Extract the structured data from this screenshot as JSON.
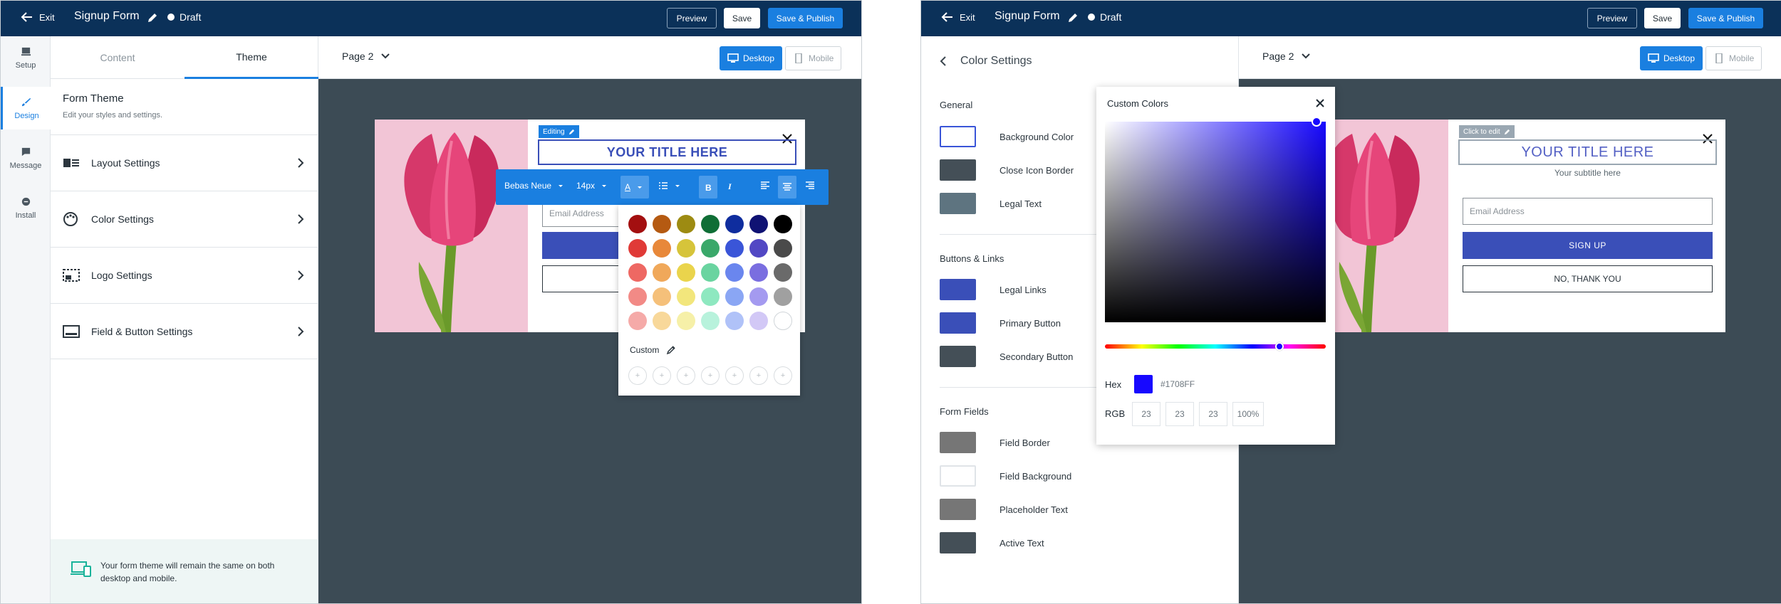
{
  "header": {
    "exit_label": "Exit",
    "form_name": "Signup Form",
    "status": "Draft",
    "preview_label": "Preview",
    "save_label": "Save",
    "publish_label": "Save & Publish"
  },
  "rail": {
    "items": [
      {
        "label": "Setup",
        "icon": "setup-icon"
      },
      {
        "label": "Design",
        "icon": "brush-icon"
      },
      {
        "label": "Message",
        "icon": "message-icon"
      },
      {
        "label": "Install",
        "icon": "install-icon"
      }
    ],
    "active": "Design"
  },
  "panel": {
    "tabs": [
      "Content",
      "Theme"
    ],
    "active_tab": "Theme",
    "title": "Form Theme",
    "subtitle": "Edit your styles and settings.",
    "sections": [
      {
        "label": "Layout Settings",
        "icon": "layout-icon"
      },
      {
        "label": "Color Settings",
        "icon": "palette-icon"
      },
      {
        "label": "Logo Settings",
        "icon": "logo-icon"
      },
      {
        "label": "Field & Button Settings",
        "icon": "field-button-icon"
      }
    ],
    "footer": "Your form theme will remain the same on both desktop and mobile."
  },
  "canvas": {
    "page_label": "Page 2",
    "desktop_label": "Desktop",
    "mobile_label": "Mobile",
    "bg_color": "#3c4b55"
  },
  "form": {
    "title": "YOUR TITLE HERE",
    "subtitle": "Your subtitle here",
    "email_placeholder": "Email Address",
    "primary_button": "SIGN UP",
    "secondary_button": "NO, THANK YOU",
    "editing_tag": "Editing",
    "click_to_edit_tag": "Click to edit",
    "accent_color": "#3a4fb8"
  },
  "toolbar": {
    "font": "Bebas Neue",
    "size": "14px",
    "text_color_icon": "A",
    "custom_label": "Custom",
    "palette": [
      [
        "#a30f10",
        "#b55a12",
        "#9d8b12",
        "#0f6e36",
        "#0f2d9e",
        "#0f1273",
        "#000000"
      ],
      [
        "#e03a37",
        "#e8883a",
        "#d6c43a",
        "#3aa86a",
        "#3a55d8",
        "#5248c4",
        "#4a4a4a"
      ],
      [
        "#ee6863",
        "#f0a85a",
        "#ead44c",
        "#6ad4a0",
        "#6a86ee",
        "#7a6ee0",
        "#6a6a6a"
      ],
      [
        "#f28a86",
        "#f5c07a",
        "#f2e67c",
        "#8ee8c0",
        "#8aa6f4",
        "#a49af0",
        "#a0a0a0"
      ],
      [
        "#f5aaa8",
        "#f8d89a",
        "#f6f0a8",
        "#b8f2dc",
        "#b0c2f8",
        "#d2c8f6",
        "#ffffff"
      ]
    ]
  },
  "color_settings": {
    "title": "Color Settings",
    "groups": [
      {
        "name": "General",
        "items": [
          {
            "label": "Background Color",
            "color": "#ffffff",
            "outline": "#3a55d8"
          },
          {
            "label": "Close Icon Border",
            "color": "#444f57"
          },
          {
            "label": "Legal Text",
            "color": "#5e7480"
          }
        ]
      },
      {
        "name": "Buttons & Links",
        "items": [
          {
            "label": "Legal Links",
            "color": "#3a4fb8"
          },
          {
            "label": "Primary Button",
            "color": "#3a4fb8"
          },
          {
            "label": "Secondary Button",
            "color": "#444f57"
          }
        ]
      },
      {
        "name": "Form Fields",
        "items": [
          {
            "label": "Field Border",
            "color": "#767676"
          },
          {
            "label": "Field Background",
            "color": "#ffffff",
            "outline": "#e0e4e8"
          },
          {
            "label": "Placeholder Text",
            "color": "#767676"
          },
          {
            "label": "Active Text",
            "color": "#444f57"
          }
        ]
      }
    ]
  },
  "picker": {
    "title": "Custom Colors",
    "hex_label": "Hex",
    "hex_value": "#1708FF",
    "rgb_label": "RGB",
    "r": "23",
    "g": "23",
    "b": "23",
    "alpha": "100%"
  }
}
